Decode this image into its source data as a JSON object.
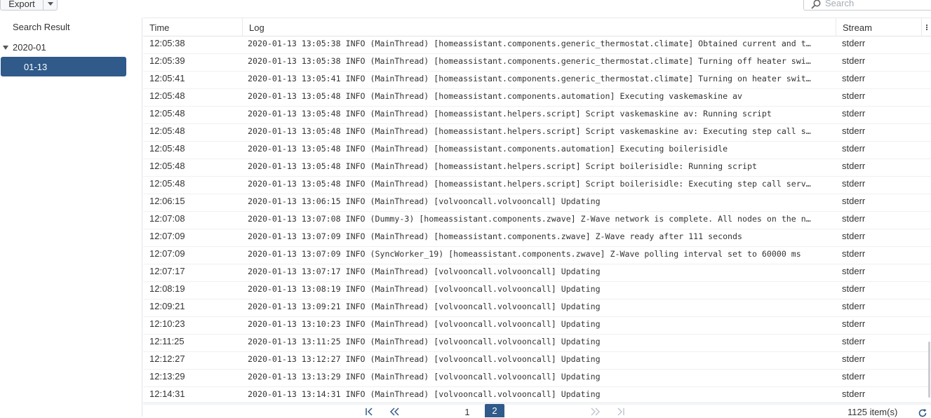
{
  "toolbar": {
    "export_label": "Export",
    "search_placeholder": "Search"
  },
  "sidebar": {
    "root_label": "Search Result",
    "year_label": "2020-01",
    "day_label": "01-13"
  },
  "grid": {
    "columns": {
      "time": "Time",
      "log": "Log",
      "stream": "Stream"
    },
    "rows": [
      {
        "time": "12:05:38",
        "log": "2020-01-13 13:05:38 INFO (MainThread) [homeassistant.components.generic_thermostat.climate] Obtained current and t…",
        "stream": "stderr"
      },
      {
        "time": "12:05:39",
        "log": "2020-01-13 13:05:38 INFO (MainThread) [homeassistant.components.generic_thermostat.climate] Turning off heater swi…",
        "stream": "stderr"
      },
      {
        "time": "12:05:41",
        "log": "2020-01-13 13:05:41 INFO (MainThread) [homeassistant.components.generic_thermostat.climate] Turning on heater swit…",
        "stream": "stderr"
      },
      {
        "time": "12:05:48",
        "log": "2020-01-13 13:05:48 INFO (MainThread) [homeassistant.components.automation] Executing vaskemaskine av",
        "stream": "stderr"
      },
      {
        "time": "12:05:48",
        "log": "2020-01-13 13:05:48 INFO (MainThread) [homeassistant.helpers.script] Script vaskemaskine av: Running script",
        "stream": "stderr"
      },
      {
        "time": "12:05:48",
        "log": "2020-01-13 13:05:48 INFO (MainThread) [homeassistant.helpers.script] Script vaskemaskine av: Executing step call s…",
        "stream": "stderr"
      },
      {
        "time": "12:05:48",
        "log": "2020-01-13 13:05:48 INFO (MainThread) [homeassistant.components.automation] Executing boilerisidle",
        "stream": "stderr"
      },
      {
        "time": "12:05:48",
        "log": "2020-01-13 13:05:48 INFO (MainThread) [homeassistant.helpers.script] Script boilerisidle: Running script",
        "stream": "stderr"
      },
      {
        "time": "12:05:48",
        "log": "2020-01-13 13:05:48 INFO (MainThread) [homeassistant.helpers.script] Script boilerisidle: Executing step call serv…",
        "stream": "stderr"
      },
      {
        "time": "12:06:15",
        "log": "2020-01-13 13:06:15 INFO (MainThread) [volvooncall.volvooncall] Updating",
        "stream": "stderr"
      },
      {
        "time": "12:07:08",
        "log": "2020-01-13 13:07:08 INFO (Dummy-3) [homeassistant.components.zwave] Z-Wave network is complete. All nodes on the n…",
        "stream": "stderr"
      },
      {
        "time": "12:07:09",
        "log": "2020-01-13 13:07:09 INFO (MainThread) [homeassistant.components.zwave] Z-Wave ready after 111 seconds",
        "stream": "stderr"
      },
      {
        "time": "12:07:09",
        "log": "2020-01-13 13:07:09 INFO (SyncWorker_19) [homeassistant.components.zwave] Z-Wave polling interval set to 60000 ms",
        "stream": "stderr"
      },
      {
        "time": "12:07:17",
        "log": "2020-01-13 13:07:17 INFO (MainThread) [volvooncall.volvooncall] Updating",
        "stream": "stderr"
      },
      {
        "time": "12:08:19",
        "log": "2020-01-13 13:08:19 INFO (MainThread) [volvooncall.volvooncall] Updating",
        "stream": "stderr"
      },
      {
        "time": "12:09:21",
        "log": "2020-01-13 13:09:21 INFO (MainThread) [volvooncall.volvooncall] Updating",
        "stream": "stderr"
      },
      {
        "time": "12:10:23",
        "log": "2020-01-13 13:10:23 INFO (MainThread) [volvooncall.volvooncall] Updating",
        "stream": "stderr"
      },
      {
        "time": "12:11:25",
        "log": "2020-01-13 13:11:25 INFO (MainThread) [volvooncall.volvooncall] Updating",
        "stream": "stderr"
      },
      {
        "time": "12:12:27",
        "log": "2020-01-13 13:12:27 INFO (MainThread) [volvooncall.volvooncall] Updating",
        "stream": "stderr"
      },
      {
        "time": "12:13:29",
        "log": "2020-01-13 13:13:29 INFO (MainThread) [volvooncall.volvooncall] Updating",
        "stream": "stderr"
      },
      {
        "time": "12:14:31",
        "log": "2020-01-13 13:14:31 INFO (MainThread) [volvooncall.volvooncall] Updating",
        "stream": "stderr"
      }
    ]
  },
  "pager": {
    "pages": [
      "1",
      "2"
    ],
    "current_page": "2",
    "item_count": "1125 item(s)"
  },
  "colors": {
    "accent": "#2f5a8a",
    "border": "#dfe3e7"
  }
}
